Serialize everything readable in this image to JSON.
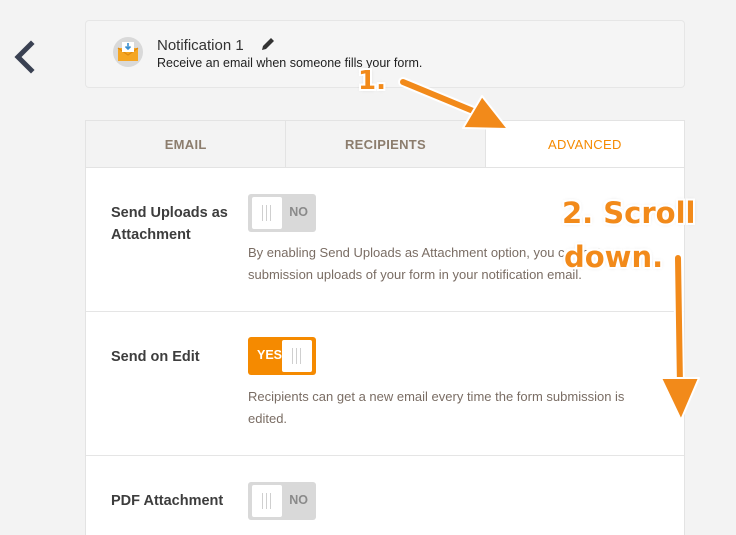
{
  "notification": {
    "title": "Notification 1",
    "description": "Receive an email when someone fills your form."
  },
  "tabs": [
    {
      "label": "EMAIL",
      "active": false
    },
    {
      "label": "RECIPIENTS",
      "active": false
    },
    {
      "label": "ADVANCED",
      "active": true
    }
  ],
  "settings": [
    {
      "label": "Send Uploads as Attachment",
      "toggle": "NO",
      "enabled": false,
      "description": "By enabling Send Uploads as Attachment option, you can get submission uploads of your form in your notification email."
    },
    {
      "label": "Send on Edit",
      "toggle": "YES",
      "enabled": true,
      "description": "Recipients can get a new email every time the form submission is edited."
    },
    {
      "label": "PDF Attachment",
      "toggle": "NO",
      "enabled": false,
      "description": ""
    }
  ],
  "annotations": {
    "step1": "1.",
    "step2_line1": "2. Scroll",
    "step2_line2": "down."
  },
  "colors": {
    "accent": "#f58a00",
    "annotation": "#f28a1a",
    "toggle_off": "#d9d9d9"
  },
  "icons": [
    "back-chevron-icon",
    "envelope-download-icon",
    "pencil-icon"
  ]
}
